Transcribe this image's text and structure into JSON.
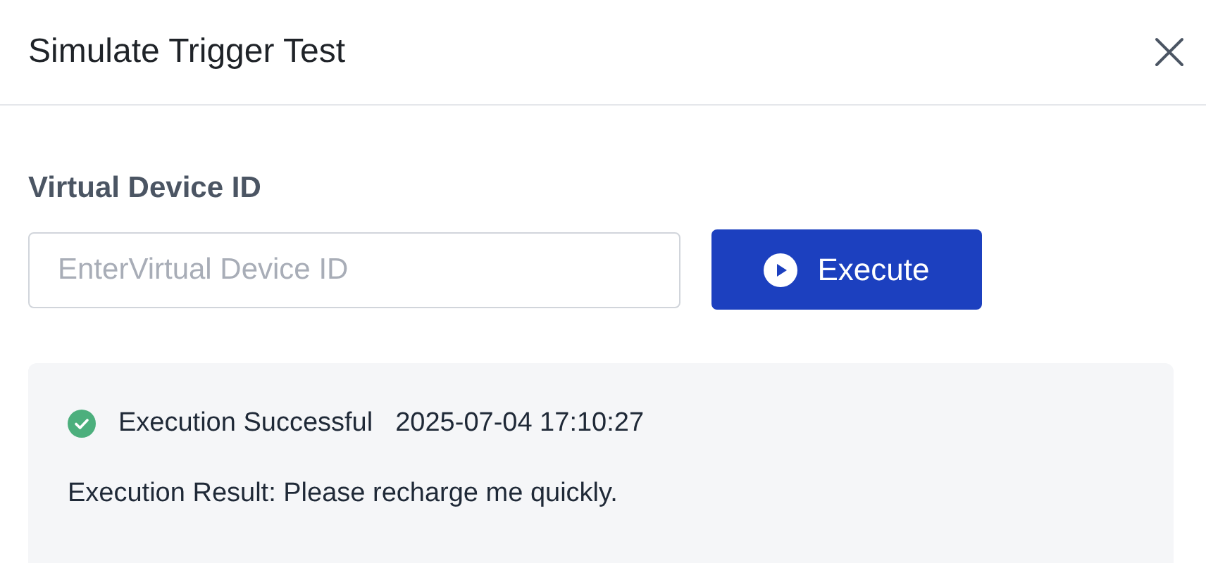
{
  "dialog": {
    "title": "Simulate Trigger Test"
  },
  "form": {
    "label": "Virtual Device ID",
    "placeholder": "EnterVirtual Device ID",
    "button": "Execute"
  },
  "result": {
    "kind": "success",
    "status_text": "Execution Successful",
    "timestamp": "2025-07-04 17:10:27",
    "message": "Execution Result: Please recharge me quickly."
  }
}
